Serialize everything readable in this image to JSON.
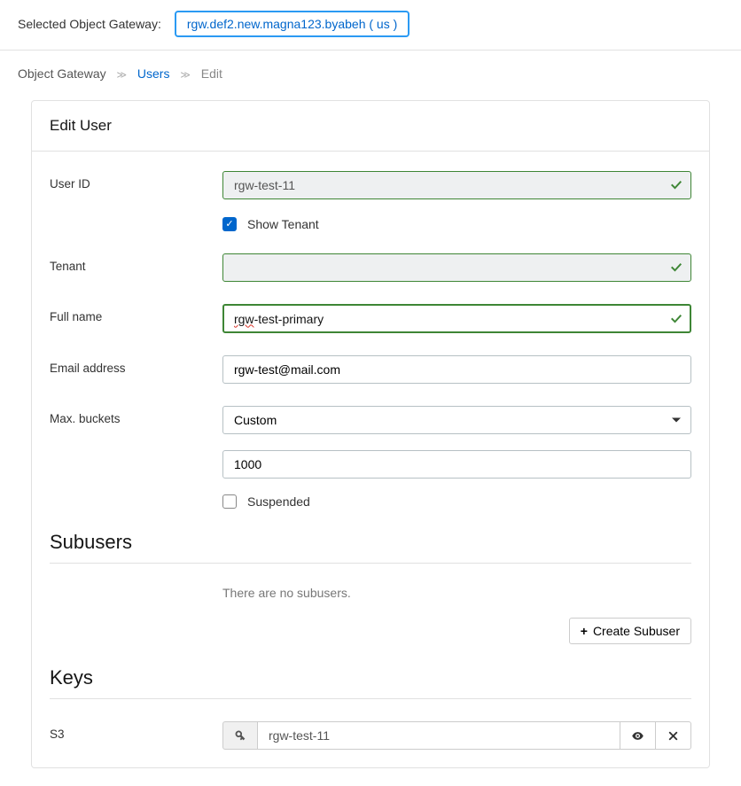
{
  "header": {
    "gateway_label": "Selected Object Gateway:",
    "gateway_value": "rgw.def2.new.magna123.byabeh ( us )"
  },
  "breadcrumbs": {
    "root": "Object Gateway",
    "parent": "Users",
    "current": "Edit"
  },
  "card": {
    "title": "Edit User"
  },
  "form": {
    "user_id_label": "User ID",
    "user_id_value": "rgw-test-11",
    "show_tenant_label": "Show Tenant",
    "tenant_label": "Tenant",
    "tenant_value": "",
    "full_name_label": "Full name",
    "full_name_prefix": "rgw",
    "full_name_suffix": "-test-primary",
    "email_label": "Email address",
    "email_value": "rgw-test@mail.com",
    "max_buckets_label": "Max. buckets",
    "max_buckets_mode": "Custom",
    "max_buckets_value": "1000",
    "suspended_label": "Suspended"
  },
  "subusers": {
    "title": "Subusers",
    "empty_text": "There are no subusers.",
    "create_button": "Create Subuser"
  },
  "keys": {
    "title": "Keys",
    "s3_label": "S3",
    "s3_value": "rgw-test-11"
  }
}
